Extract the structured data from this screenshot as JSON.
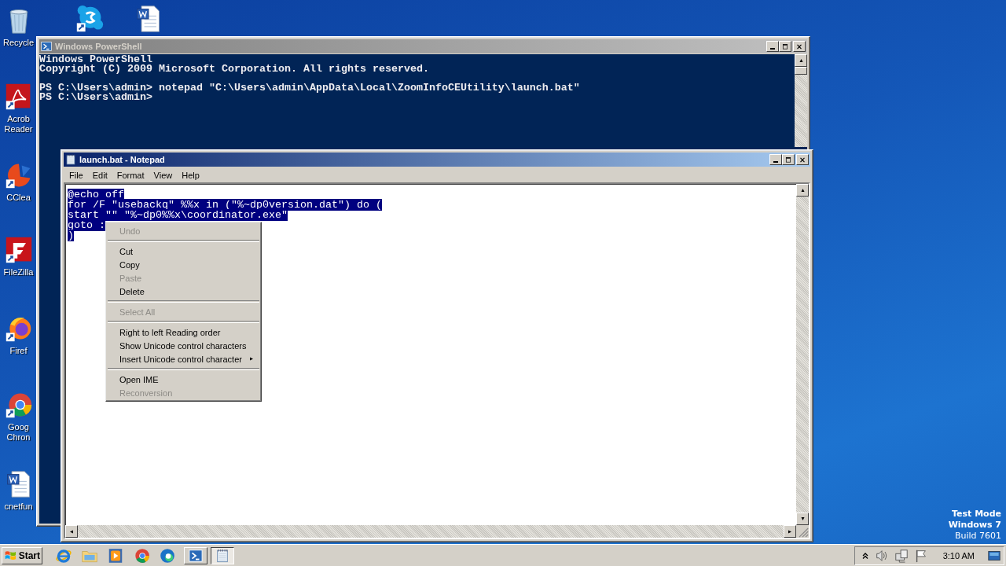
{
  "desktop_icons": [
    {
      "kind": "recycle",
      "label": "Recycle"
    },
    {
      "kind": "chat"
    },
    {
      "kind": "word"
    },
    {
      "kind": "pdf",
      "label": "Acrob Reader"
    },
    {
      "kind": "cleaner",
      "label": "CClea"
    },
    {
      "kind": "ftp",
      "label": "FileZilla"
    },
    {
      "kind": "firefox",
      "label": "Firef"
    },
    {
      "kind": "chrome",
      "label": "Goog Chron"
    },
    {
      "kind": "word",
      "label": "cnetfun"
    }
  ],
  "os_notice": [
    {
      "text": "Test Mode",
      "bold": true
    },
    {
      "text": "Windows 7",
      "bold": true
    },
    {
      "text": "Build 7601",
      "bold": false
    }
  ],
  "powershell": {
    "title": "Windows PowerShell",
    "active": false,
    "blocks": [
      [
        "Windows PowerShell",
        "Copyright (C) 2009 Microsoft Corporation. All rights reserved."
      ],
      [
        "PS C:\\Users\\admin> notepad \"C:\\Users\\admin\\AppData\\Local\\ZoomInfoCEUtility\\launch.bat\"",
        "PS C:\\Users\\admin>"
      ]
    ]
  },
  "notepad": {
    "title": "launch.bat - Notepad",
    "active": true,
    "menu": [
      "File",
      "Edit",
      "Format",
      "View",
      "Help"
    ],
    "lines": [
      {
        "text": "@echo off",
        "selected": true
      },
      {
        "text": "for /F \"usebackq\" %%x in (\"%~dp0version.dat\") do (",
        "selected": true
      },
      {
        "text": "start \"\" \"%~dp0%%x\\coordinator.exe\"",
        "selected": true
      },
      {
        "text": "goto :",
        "selected": true
      },
      {
        "text": ")",
        "selected": true
      }
    ]
  },
  "context_menu": [
    {
      "kind": "item",
      "label": "Undo",
      "disabled": true,
      "submenu": false
    },
    {
      "kind": "separator"
    },
    {
      "kind": "item",
      "label": "Cut",
      "disabled": false,
      "submenu": false
    },
    {
      "kind": "item",
      "label": "Copy",
      "disabled": false,
      "submenu": false
    },
    {
      "kind": "item",
      "label": "Paste",
      "disabled": true,
      "submenu": false
    },
    {
      "kind": "item",
      "label": "Delete",
      "disabled": false,
      "submenu": false
    },
    {
      "kind": "separator"
    },
    {
      "kind": "item",
      "label": "Select All",
      "disabled": true,
      "submenu": false
    },
    {
      "kind": "separator"
    },
    {
      "kind": "item",
      "label": "Right to left Reading order",
      "disabled": false,
      "submenu": false
    },
    {
      "kind": "item",
      "label": "Show Unicode control characters",
      "disabled": false,
      "submenu": false
    },
    {
      "kind": "item",
      "label": "Insert Unicode control character",
      "disabled": false,
      "submenu": true
    },
    {
      "kind": "separator"
    },
    {
      "kind": "item",
      "label": "Open IME",
      "disabled": false,
      "submenu": false
    },
    {
      "kind": "item",
      "label": "Reconversion",
      "disabled": true,
      "submenu": false
    }
  ],
  "taskbar": {
    "start": "Start",
    "quick_launch": [
      {
        "kind": "ie"
      },
      {
        "kind": "folder"
      },
      {
        "kind": "media"
      },
      {
        "kind": "chrome"
      },
      {
        "kind": "edge"
      }
    ],
    "tasks": [
      {
        "kind": "shell",
        "selected": false
      },
      {
        "kind": "notepad",
        "selected": true
      }
    ],
    "clock": "3:10 AM"
  }
}
